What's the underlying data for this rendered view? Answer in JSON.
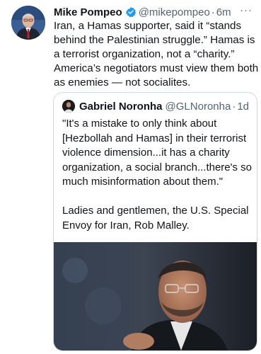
{
  "tweet": {
    "author_name": "Mike Pompeo",
    "author_handle": "@mikepompeo",
    "separator": "·",
    "time": "6m",
    "more_menu": "···",
    "text": "Iran, a Hamas supporter, said it “stands behind the Palestinian struggle.” Hamas is a terrorist organization, not a “charity.” America’s negotiators must view them both as enemies — not socialites.",
    "verified_icon": "verified-badge-icon",
    "accent_color": "#1d9bf0"
  },
  "quoted_tweet": {
    "author_name": "Gabriel Noronha",
    "author_handle": "@GLNoronha",
    "separator": "·",
    "time": "1d",
    "text": "\"It's a mistake to only think about [Hezbollah and Hamas] in their terrorist violence dimension...it has a charity organization, a social branch...there's so much misinformation about them.\"\n\nLadies and gentlemen, the U.S. Special Envoy for Iran, Rob Malley."
  }
}
